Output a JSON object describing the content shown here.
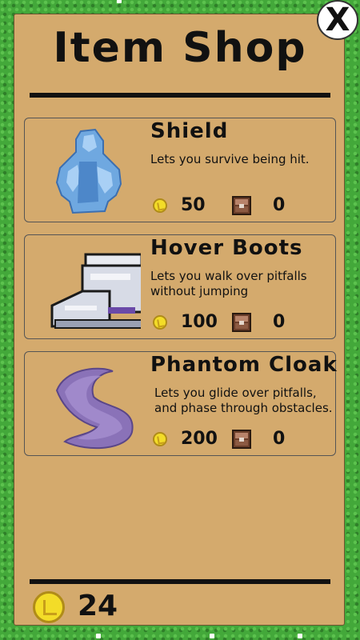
{
  "shop": {
    "title": "Item Shop",
    "close_label": "X",
    "coin_balance": "24"
  },
  "items": [
    {
      "name": "Shield",
      "description": "Lets you survive being hit.",
      "price": "50",
      "owned": "0",
      "icon": "shield-crystal-icon"
    },
    {
      "name": "Hover Boots",
      "description": "Lets you walk over pitfalls without jumping",
      "price": "100",
      "owned": "0",
      "icon": "hover-boots-icon"
    },
    {
      "name": "Phantom Cloak",
      "description": "Lets you glide over pitfalls, and phase through obstacles.",
      "price": "200",
      "owned": "0",
      "icon": "phantom-cloak-icon"
    }
  ],
  "colors": {
    "panel": "#d4aa6d",
    "grass": "#43a83a",
    "coin": "#f3dc28",
    "text": "#111111"
  }
}
